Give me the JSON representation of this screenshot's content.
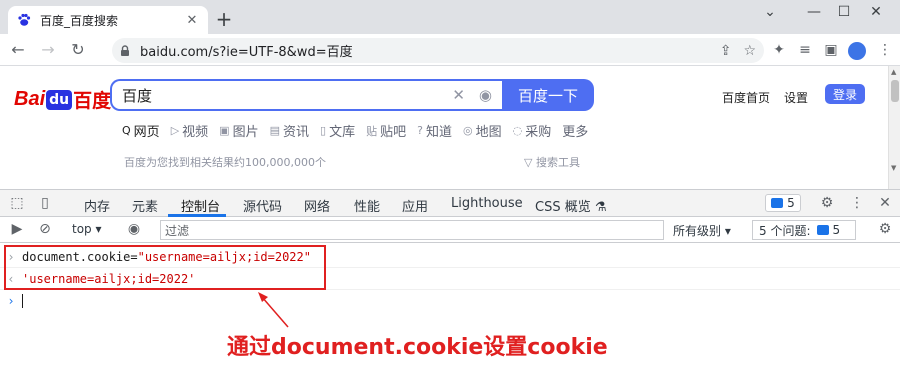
{
  "browser": {
    "tab_title": "百度_百度搜索",
    "url": "baidu.com/s?ie=UTF-8&wd=百度",
    "icons": [
      "back-icon",
      "forward-icon",
      "reload-icon",
      "lock-icon",
      "share-icon",
      "star-icon",
      "extensions-icon",
      "reading-list-icon",
      "side-panel-icon",
      "profile-avatar",
      "menu-icon"
    ]
  },
  "page": {
    "logo_bai": "Bai",
    "logo_du": "du",
    "logo_cn": "百度",
    "search_query": "百度",
    "search_button": "百度一下",
    "links": {
      "home": "百度首页",
      "settings": "设置",
      "login": "登录"
    },
    "scope_tabs": [
      {
        "label": "网页",
        "icon": "Q"
      },
      {
        "label": "视频",
        "icon": "▷"
      },
      {
        "label": "图片",
        "icon": "▣"
      },
      {
        "label": "资讯",
        "icon": "▤"
      },
      {
        "label": "文库",
        "icon": "▯"
      },
      {
        "label": "贴吧",
        "icon": "贴"
      },
      {
        "label": "知道",
        "icon": "?"
      },
      {
        "label": "地图",
        "icon": "◎"
      },
      {
        "label": "采购",
        "icon": "◌"
      },
      {
        "label": "更多",
        "icon": ""
      }
    ],
    "result_count": "百度为您找到相关结果约100,000,000个",
    "search_tools": "搜索工具"
  },
  "devtools": {
    "tabs": [
      "内存",
      "元素",
      "控制台",
      "源代码",
      "网络",
      "性能",
      "应用",
      "Lighthouse",
      "CSS 概览"
    ],
    "active_tab": "控制台",
    "issues_badge": "5",
    "context": "top",
    "filter_placeholder": "过滤",
    "levels": "所有级别",
    "issues_label": "5 个问题:",
    "issues_count": "5",
    "console": {
      "input_prefix": "document.cookie=",
      "input_string": "\"username=ailjx;id=2022\"",
      "output": "'username=ailjx;id=2022'"
    }
  },
  "annotation": {
    "text": "通过document.cookie设置cookie",
    "color": "#e02020"
  },
  "colors": {
    "baidu_blue": "#4e6ef2",
    "baidu_red": "#e10602",
    "chrome_blue": "#1a73e8"
  }
}
